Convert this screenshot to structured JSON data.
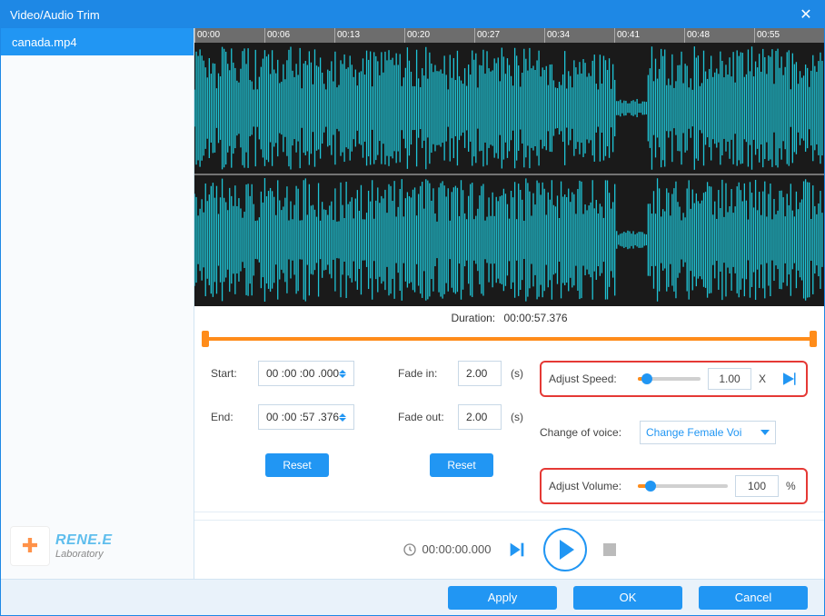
{
  "titlebar": {
    "title": "Video/Audio Trim"
  },
  "sidebar": {
    "file": "canada.mp4",
    "logo_line1": "RENE.E",
    "logo_line2": "Laboratory"
  },
  "ruler": {
    "ticks": [
      "00:00",
      "00:06",
      "00:13",
      "00:20",
      "00:27",
      "00:34",
      "00:41",
      "00:48",
      "00:55"
    ]
  },
  "duration": {
    "label": "Duration:",
    "value": "00:00:57.376"
  },
  "startend": {
    "start_label": "Start:",
    "start_value": "00 :00 :00 .000",
    "end_label": "End:",
    "end_value": "00 :00 :57 .376",
    "reset": "Reset"
  },
  "fade": {
    "in_label": "Fade in:",
    "in_value": "2.00",
    "in_unit": "(s)",
    "out_label": "Fade out:",
    "out_value": "2.00",
    "out_unit": "(s)",
    "reset": "Reset"
  },
  "speed": {
    "label": "Adjust Speed:",
    "value": "1.00",
    "unit": "X"
  },
  "voice": {
    "label": "Change of voice:",
    "selected": "Change Female Voi"
  },
  "volume": {
    "label": "Adjust Volume:",
    "value": "100",
    "unit": "%"
  },
  "playback": {
    "time": "00:00:00.000"
  },
  "footer": {
    "apply": "Apply",
    "ok": "OK",
    "cancel": "Cancel"
  }
}
